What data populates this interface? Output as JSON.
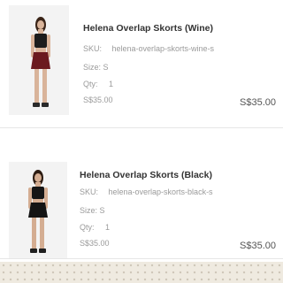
{
  "items": [
    {
      "title": "Helena Overlap Skorts (Wine)",
      "sku_label": "SKU:",
      "sku_value": "helena-overlap-skorts-wine-s",
      "size": "Size: S",
      "qty_label": "Qty:",
      "qty_value": "1",
      "unit_price": "S$35.00",
      "total_price": "S$35.00",
      "skirt_color": "#6b1a1f"
    },
    {
      "title": "Helena Overlap Skorts (Black)",
      "sku_label": "SKU:",
      "sku_value": "helena-overlap-skorts-black-s",
      "size": "Size: S",
      "qty_label": "Qty:",
      "qty_value": "1",
      "unit_price": "S$35.00",
      "total_price": "S$35.00",
      "skirt_color": "#141414"
    }
  ],
  "colors": {
    "title_text": "#333333",
    "meta_text": "#9a9a9a",
    "price_text": "#555555"
  }
}
